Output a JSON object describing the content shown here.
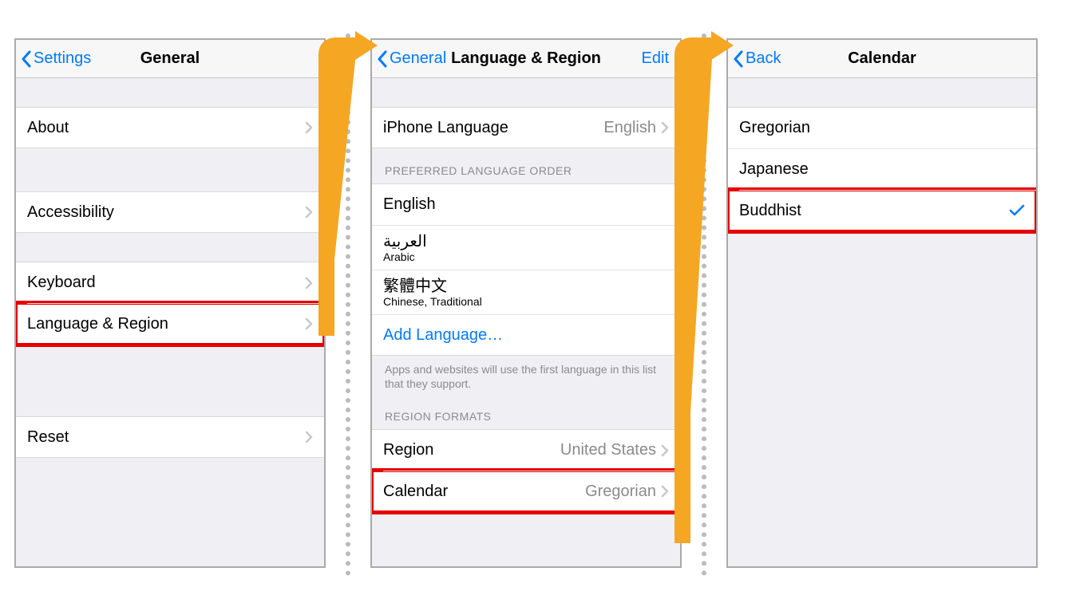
{
  "panel1": {
    "nav": {
      "back": "Settings",
      "title": "General"
    },
    "rows": {
      "about": "About",
      "accessibility": "Accessibility",
      "keyboard": "Keyboard",
      "language_region": "Language & Region",
      "reset": "Reset"
    }
  },
  "panel2": {
    "nav": {
      "back": "General",
      "title": "Language & Region",
      "edit": "Edit"
    },
    "iphone_language": {
      "label": "iPhone Language",
      "value": "English"
    },
    "preferred_header": "PREFERRED LANGUAGE ORDER",
    "languages": [
      {
        "native": "English",
        "sub": ""
      },
      {
        "native": "العربية",
        "sub": "Arabic"
      },
      {
        "native": "繁體中文",
        "sub": "Chinese, Traditional"
      }
    ],
    "add_language": "Add Language…",
    "footer": "Apps and websites will use the first language in this list that they support.",
    "region_formats_header": "REGION FORMATS",
    "region": {
      "label": "Region",
      "value": "United States"
    },
    "calendar": {
      "label": "Calendar",
      "value": "Gregorian"
    }
  },
  "panel3": {
    "nav": {
      "back": "Back",
      "title": "Calendar"
    },
    "options": {
      "gregorian": "Gregorian",
      "japanese": "Japanese",
      "buddhist": "Buddhist"
    }
  }
}
